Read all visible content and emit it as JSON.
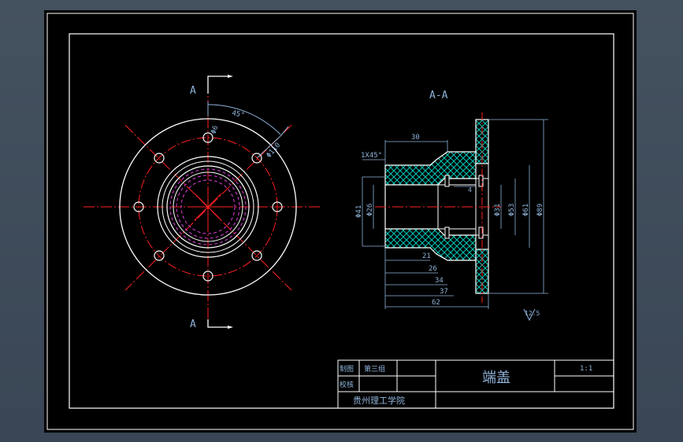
{
  "section_labels": {
    "a_top": "A",
    "a_bottom": "A",
    "section_title": "A-A"
  },
  "front_view": {
    "angle_dim": "45°",
    "hole_dim": "Φ6",
    "bolt_circle_dim": "Φ110"
  },
  "section_view": {
    "chamfer": "1X45°",
    "dim_30": "30",
    "dim_21": "21",
    "dim_26": "26",
    "dim_34": "34",
    "dim_37": "37",
    "dim_62": "62",
    "dia_41": "Φ41",
    "dia_26": "Φ26",
    "dia_31": "Φ31",
    "dia_53": "Φ53",
    "dia_61": "Φ61",
    "dia_89": "Φ89",
    "small_dim": "4",
    "roughness": "12.5"
  },
  "title_block": {
    "drawn_label": "制图",
    "drawn_value": "第三组",
    "check_label": "校核",
    "part_name": "端盖",
    "scale": "1:1",
    "school": "贵州理工学院"
  },
  "colors": {
    "background": "#000000",
    "line": "#ffffff",
    "centerline": "#ff2020",
    "dimension": "#8fb3d9",
    "hatch": "#00d0c0",
    "hidden": "#e040e0",
    "outside": "#3d4a59"
  }
}
